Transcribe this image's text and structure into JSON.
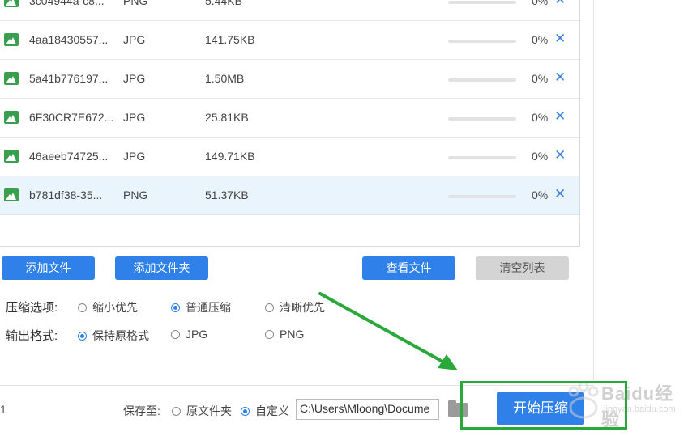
{
  "files": [
    {
      "name": "3c04944a-c8...",
      "type": "PNG",
      "size": "5.44KB",
      "progress": 0,
      "progress_text": "0%"
    },
    {
      "name": "4aa18430557...",
      "type": "JPG",
      "size": "141.75KB",
      "progress": 0,
      "progress_text": "0%"
    },
    {
      "name": "5a41b776197...",
      "type": "JPG",
      "size": "1.50MB",
      "progress": 0,
      "progress_text": "0%"
    },
    {
      "name": "6F30CR7E672...",
      "type": "JPG",
      "size": "25.81KB",
      "progress": 0,
      "progress_text": "0%"
    },
    {
      "name": "46aeeb74725...",
      "type": "JPG",
      "size": "149.71KB",
      "progress": 0,
      "progress_text": "0%"
    },
    {
      "name": "b781df38-35...",
      "type": "PNG",
      "size": "51.37KB",
      "progress": 0,
      "progress_text": "0%",
      "selected": true
    }
  ],
  "remove_glyph": "✕",
  "buttons": {
    "add_file": "添加文件",
    "add_folder": "添加文件夹",
    "view_files": "查看文件",
    "clear_list": "清空列表"
  },
  "compress_options": {
    "label": "压缩选项:",
    "choices": [
      "缩小优先",
      "普通压缩",
      "清晰优先"
    ],
    "selected": "普通压缩"
  },
  "output_format": {
    "label": "输出格式:",
    "choices": [
      "保持原格式",
      "JPG",
      "PNG"
    ],
    "selected": "保持原格式"
  },
  "footer": {
    "count_text": "1",
    "save_to_label": "保存至:",
    "save_choices": [
      "原文件夹",
      "自定义"
    ],
    "save_selected": "自定义",
    "path_value": "C:\\Users\\Mloong\\Docume",
    "start_label": "开始压缩"
  },
  "watermark": {
    "text": "Baidu经验",
    "sub": "jingyan.baidu.com"
  },
  "colors": {
    "accent": "#2f80e8",
    "annotation": "#2aa83a",
    "selected_row": "#e9f4fd",
    "file_icon": "#3a9e4f"
  }
}
